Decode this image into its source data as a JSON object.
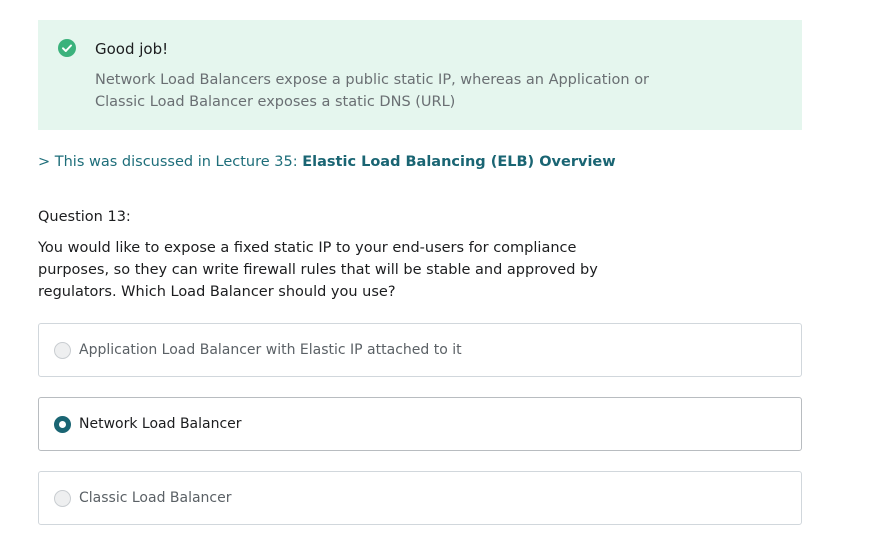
{
  "feedback": {
    "title": "Good job!",
    "body": "Network Load Balancers expose a public static IP, whereas an Application or Classic Load Balancer exposes a static DNS (URL)",
    "icon": "check-circle-icon",
    "accent": "#3bb27c",
    "background": "#e5f6ee"
  },
  "lecture_link": {
    "prefix": "> This was discussed in Lecture 35: ",
    "title": "Elastic Load Balancing (ELB) Overview",
    "color": "#1a6573"
  },
  "question": {
    "number_label": "Question 13:",
    "text": "You would like to expose a fixed static IP to your end-users for compliance purposes, so they can write firewall rules that will be stable and approved by regulators. Which Load Balancer should you use?"
  },
  "options": [
    {
      "label": "Application Load Balancer with Elastic IP attached to it",
      "selected": false
    },
    {
      "label": "Network Load Balancer",
      "selected": true
    },
    {
      "label": "Classic Load Balancer",
      "selected": false
    }
  ]
}
